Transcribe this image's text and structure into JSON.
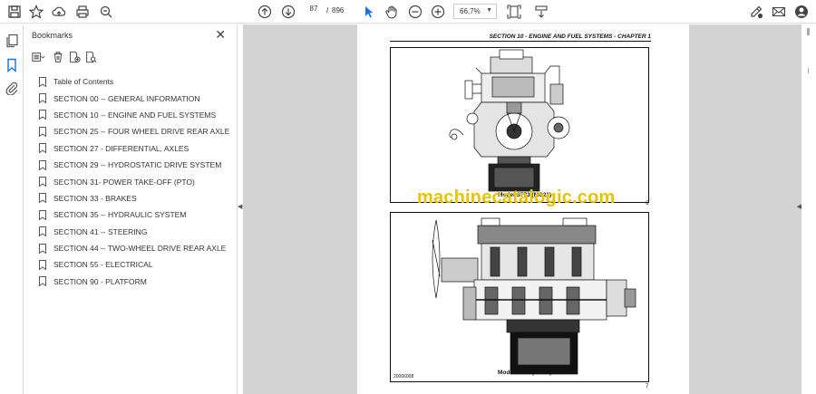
{
  "toolbar": {
    "current_page": "87",
    "page_separator": "/",
    "total_pages": "896",
    "zoom": "66,7%"
  },
  "bookmarks": {
    "title": "Bookmarks",
    "items": [
      {
        "label": "Table of Contents"
      },
      {
        "label": "SECTION 00 -- GENERAL INFORMATION"
      },
      {
        "label": "SECTION 10 -- ENGINE AND FUEL SYSTEMS"
      },
      {
        "label": "SECTION 25 -- FOUR WHEEL DRIVE REAR AXLE"
      },
      {
        "label": "SECTION 27 - DIFFERENTIAL, AXLES"
      },
      {
        "label": "SECTION 29 -- HYDROSTATIC DRIVE SYSTEM"
      },
      {
        "label": "SECTION 31- POWER TAKE-OFF (PTO)"
      },
      {
        "label": "SECTION 33 - BRAKES"
      },
      {
        "label": "SECTION 35 -- HYDRAULIC SYSTEM"
      },
      {
        "label": "SECTION 41 -- STEERING"
      },
      {
        "label": "SECTION 44 -- TWO-WHEEL DRIVE REAR AXLE"
      },
      {
        "label": "SECTION 55 - ELECTRICAL"
      },
      {
        "label": "SECTION 90 - PLATFORM"
      }
    ]
  },
  "document": {
    "header": "SECTION 10 - ENGINE AND FUEL SYSTEMS - CHAPTER 1",
    "fig1_caption": "Model S773 (MC22)",
    "fig1_number": "6",
    "fig2_caption": "Model S773 (MC22)",
    "fig2_number": "7",
    "fig2_code": "20006008",
    "watermark": "machinecatalogic.com"
  },
  "colors": {
    "viewer_bg": "#d3d3d3",
    "watermark": "#e8c300",
    "active_icon": "#1473e6"
  }
}
